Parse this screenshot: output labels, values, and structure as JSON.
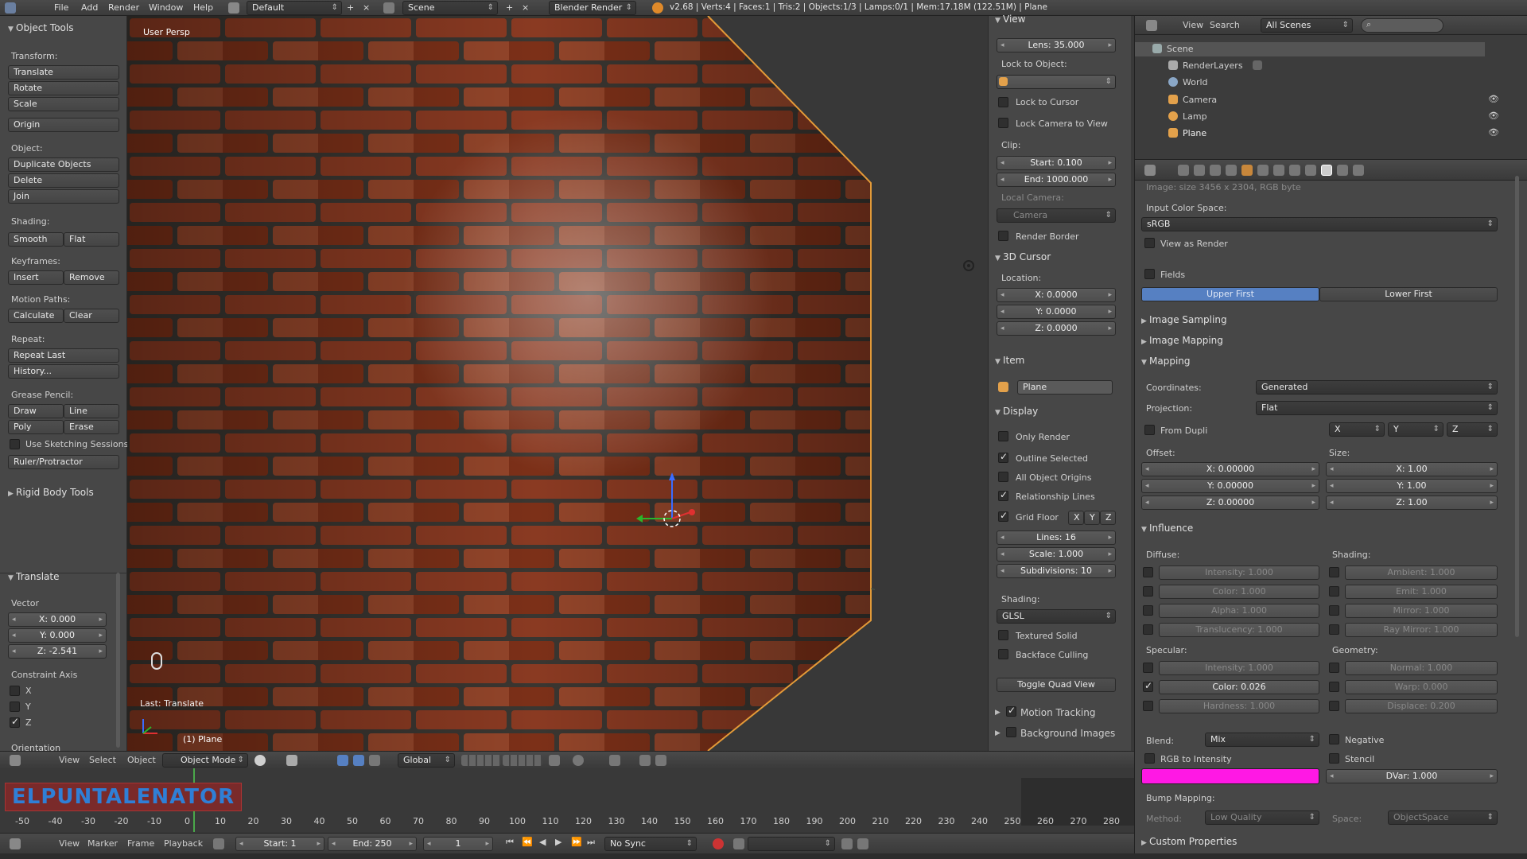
{
  "topbar": {
    "menus": [
      "File",
      "Add",
      "Render",
      "Window",
      "Help"
    ],
    "screen_layout": "Default",
    "scene": "Scene",
    "render_engine": "Blender Render",
    "stats": "v2.68 | Verts:4 | Faces:1 | Tris:2 | Objects:1/3 | Lamps:0/1 | Mem:17.18M (122.51M) | Plane"
  },
  "toolshelf": {
    "title": "Object Tools",
    "transform_label": "Transform:",
    "translate": "Translate",
    "rotate": "Rotate",
    "scale": "Scale",
    "origin": "Origin",
    "object_label": "Object:",
    "duplicate": "Duplicate Objects",
    "delete": "Delete",
    "join": "Join",
    "shading_label": "Shading:",
    "smooth": "Smooth",
    "flat": "Flat",
    "keyframes_label": "Keyframes:",
    "insert": "Insert",
    "remove": "Remove",
    "motion_paths_label": "Motion Paths:",
    "calculate": "Calculate",
    "clear": "Clear",
    "repeat_label": "Repeat:",
    "repeat_last": "Repeat Last",
    "history": "History...",
    "grease_pencil_label": "Grease Pencil:",
    "draw": "Draw",
    "line": "Line",
    "poly": "Poly",
    "erase": "Erase",
    "use_sketching": "Use Sketching Sessions",
    "ruler": "Ruler/Protractor",
    "rigid_body": "Rigid Body Tools",
    "op_title": "Translate",
    "vector_label": "Vector",
    "vx": "X: 0.000",
    "vy": "Y: 0.000",
    "vz": "Z: -2.541",
    "constraint_label": "Constraint Axis",
    "cx": "X",
    "cy": "Y",
    "cz": "Z",
    "orientation_label": "Orientation"
  },
  "viewport": {
    "view_name": "User Persp",
    "last_op": "Last: Translate",
    "object_name": "(1) Plane"
  },
  "npanel": {
    "view_header": "View",
    "lens": "Lens: 35.000",
    "lock_to_object": "Lock to Object:",
    "lock_to_cursor": "Lock to Cursor",
    "lock_camera": "Lock Camera to View",
    "clip_label": "Clip:",
    "clip_start": "Start: 0.100",
    "clip_end": "End: 1000.000",
    "local_camera": "Local Camera:",
    "camera": "Camera",
    "render_border": "Render Border",
    "cursor_header": "3D Cursor",
    "location_label": "Location:",
    "cur_x": "X: 0.0000",
    "cur_y": "Y: 0.0000",
    "cur_z": "Z: 0.0000",
    "item_header": "Item",
    "item_name": "Plane",
    "display_header": "Display",
    "only_render": "Only Render",
    "outline_selected": "Outline Selected",
    "all_object_origins": "All Object Origins",
    "relationship_lines": "Relationship Lines",
    "grid_floor": "Grid Floor",
    "gx": "X",
    "gy": "Y",
    "gz": "Z",
    "lines": "Lines: 16",
    "scale": "Scale: 1.000",
    "subdivisions": "Subdivisions: 10",
    "shading_label": "Shading:",
    "shading_mode": "GLSL",
    "textured_solid": "Textured Solid",
    "backface_culling": "Backface Culling",
    "toggle_quad": "Toggle Quad View",
    "motion_tracking": "Motion Tracking",
    "background_images": "Background Images"
  },
  "outliner": {
    "view": "View",
    "search": "Search",
    "scenes": "All Scenes",
    "items": [
      "Scene",
      "RenderLayers",
      "World",
      "Camera",
      "Lamp",
      "Plane"
    ]
  },
  "properties": {
    "image_info": "Image: size 3456 x 2304, RGB byte",
    "input_color_space": "Input Color Space:",
    "color_space": "sRGB",
    "view_as_render": "View as Render",
    "fields": "Fields",
    "upper_first": "Upper First",
    "lower_first": "Lower First",
    "image_sampling": "Image Sampling",
    "image_mapping": "Image Mapping",
    "mapping": "Mapping",
    "coordinates_label": "Coordinates:",
    "coordinates": "Generated",
    "projection_label": "Projection:",
    "projection": "Flat",
    "from_dupli": "From Dupli",
    "px": "X",
    "py": "Y",
    "pz": "Z",
    "offset_label": "Offset:",
    "size_label": "Size:",
    "ox": "X: 0.00000",
    "oy": "Y: 0.00000",
    "oz": "Z: 0.00000",
    "sx": "X: 1.00",
    "sy": "Y: 1.00",
    "sz": "Z: 1.00",
    "influence": "Influence",
    "diffuse_label": "Diffuse:",
    "shading_label": "Shading:",
    "d_intensity": "Intensity: 1.000",
    "d_color": "Color: 1.000",
    "d_alpha": "Alpha: 1.000",
    "d_translucency": "Translucency: 1.000",
    "s_ambient": "Ambient: 1.000",
    "s_emit": "Emit: 1.000",
    "s_mirror": "Mirror: 1.000",
    "s_raymirror": "Ray Mirror: 1.000",
    "specular_label": "Specular:",
    "geometry_label": "Geometry:",
    "sp_intensity": "Intensity: 1.000",
    "sp_color": "Color: 0.026",
    "sp_hardness": "Hardness: 1.000",
    "g_normal": "Normal: 1.000",
    "g_warp": "Warp: 0.000",
    "g_displace": "Displace: 0.200",
    "blend_label": "Blend:",
    "blend": "Mix",
    "negative": "Negative",
    "rgb_to_intensity": "RGB to Intensity",
    "stencil": "Stencil",
    "dvar": "DVar: 1.000",
    "bump_mapping": "Bump Mapping:",
    "method_label": "Method:",
    "method": "Low Quality",
    "space_label": "Space:",
    "space": "ObjectSpace",
    "custom_properties": "Custom Properties",
    "swatch_color": "#ff18e4"
  },
  "v3dheader": {
    "view": "View",
    "select": "Select",
    "object": "Object",
    "mode": "Object Mode",
    "orientation": "Global"
  },
  "timeline": {
    "watermark": "ELPUNTALENATOR",
    "ticks": [
      "-50",
      "-40",
      "-30",
      "-20",
      "-10",
      "0",
      "10",
      "20",
      "30",
      "40",
      "50",
      "60",
      "70",
      "80",
      "90",
      "100",
      "110",
      "120",
      "130",
      "140",
      "150",
      "160",
      "170",
      "180",
      "190",
      "200",
      "210",
      "220",
      "230",
      "240",
      "250",
      "260",
      "270",
      "280"
    ],
    "view": "View",
    "marker": "Marker",
    "frame": "Frame",
    "playback": "Playback",
    "start": "Start: 1",
    "end": "End: 250",
    "current": "1",
    "sync": "No Sync"
  }
}
